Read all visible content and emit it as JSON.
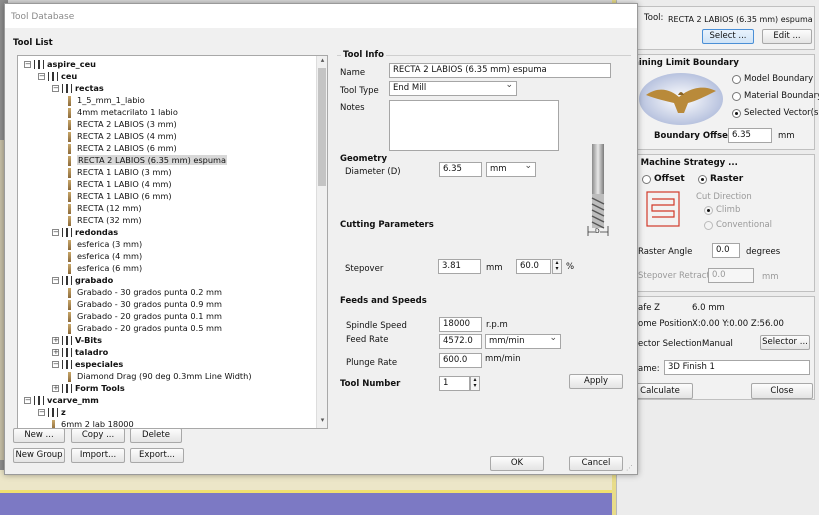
{
  "dialog": {
    "title": "Tool Database",
    "tool_list_label": "Tool List",
    "tree": [
      {
        "label": "aspire_ceu",
        "level": 0,
        "kind": "folder",
        "bold": true
      },
      {
        "label": "ceu",
        "level": 1,
        "kind": "folder",
        "bold": true
      },
      {
        "label": "rectas",
        "level": 2,
        "kind": "folder",
        "bold": true
      },
      {
        "label": "1_5_mm_1_labio",
        "level": 3,
        "kind": "tool"
      },
      {
        "label": "4mm metacrilato 1 labio",
        "level": 3,
        "kind": "tool"
      },
      {
        "label": "RECTA 2 LABIOS (3 mm)",
        "level": 3,
        "kind": "tool"
      },
      {
        "label": "RECTA 2 LABIOS (4 mm)",
        "level": 3,
        "kind": "tool"
      },
      {
        "label": "RECTA 2 LABIOS (6 mm)",
        "level": 3,
        "kind": "tool"
      },
      {
        "label": "RECTA 2 LABIOS (6.35 mm) espuma",
        "level": 3,
        "kind": "tool",
        "selected": true
      },
      {
        "label": "RECTA 1 LABIO (3 mm)",
        "level": 3,
        "kind": "tool"
      },
      {
        "label": "RECTA 1 LABIO (4 mm)",
        "level": 3,
        "kind": "tool"
      },
      {
        "label": "RECTA 1 LABIO (6 mm)",
        "level": 3,
        "kind": "tool"
      },
      {
        "label": "RECTA (12 mm)",
        "level": 3,
        "kind": "tool"
      },
      {
        "label": "RECTA (32 mm)",
        "level": 3,
        "kind": "tool"
      },
      {
        "label": "redondas",
        "level": 2,
        "kind": "folder",
        "bold": true
      },
      {
        "label": "esferica (3 mm)",
        "level": 3,
        "kind": "tool"
      },
      {
        "label": "esferica (4 mm)",
        "level": 3,
        "kind": "tool"
      },
      {
        "label": "esferica (6 mm)",
        "level": 3,
        "kind": "tool"
      },
      {
        "label": "grabado",
        "level": 2,
        "kind": "folder",
        "bold": true
      },
      {
        "label": "Grabado - 30 grados punta 0.2  mm",
        "level": 3,
        "kind": "tool"
      },
      {
        "label": "Grabado - 30 grados punta 0.9  mm",
        "level": 3,
        "kind": "tool"
      },
      {
        "label": "Grabado - 20 grados punta 0.1  mm",
        "level": 3,
        "kind": "tool"
      },
      {
        "label": "Grabado - 20 grados punta 0.5  mm",
        "level": 3,
        "kind": "tool"
      },
      {
        "label": "V-Bits",
        "level": 2,
        "kind": "folder",
        "bold": true,
        "collapsed": true
      },
      {
        "label": "taladro",
        "level": 2,
        "kind": "folder",
        "bold": true,
        "collapsed": true
      },
      {
        "label": "especiales",
        "level": 2,
        "kind": "folder",
        "bold": true
      },
      {
        "label": "Diamond Drag (90 deg 0.3mm Line Width)",
        "level": 3,
        "kind": "tool"
      },
      {
        "label": "Form Tools",
        "level": 2,
        "kind": "folder",
        "bold": true,
        "collapsed": true
      },
      {
        "label": "vcarve_mm",
        "level": 0,
        "kind": "folder",
        "bold": true
      },
      {
        "label": "z",
        "level": 1,
        "kind": "folder",
        "bold": true
      },
      {
        "label": "6mm 2 lab 18000",
        "level": 2,
        "kind": "tool"
      }
    ],
    "buttons": {
      "new": "New ...",
      "copy": "Copy ...",
      "delete": "Delete",
      "new_group": "New Group",
      "import": "Import...",
      "export": "Export...",
      "ok": "OK",
      "cancel": "Cancel",
      "apply": "Apply"
    },
    "tool_info": {
      "heading": "Tool Info",
      "name_label": "Name",
      "name_value": "RECTA 2 LABIOS (6.35 mm) espuma",
      "type_label": "Tool Type",
      "type_value": "End Mill",
      "notes_label": "Notes",
      "notes_value": ""
    },
    "geometry": {
      "heading": "Geometry",
      "diameter_label": "Diameter (D)",
      "diameter_value": "6.35",
      "units_value": "mm",
      "d_symbol": "D"
    },
    "cutting": {
      "heading": "Cutting Parameters",
      "stepover_label": "Stepover",
      "stepover_value": "3.81",
      "stepover_unit": "mm",
      "stepover_pct": "60.0",
      "pct_sign": "%"
    },
    "feeds": {
      "heading": "Feeds and Speeds",
      "spindle_label": "Spindle Speed",
      "spindle_value": "18000",
      "spindle_unit": "r.p.m",
      "feed_label": "Feed Rate",
      "feed_value": "4572.0",
      "feed_unit": "mm/min",
      "plunge_label": "Plunge Rate",
      "plunge_value": "600.0",
      "plunge_unit": "mm/min"
    },
    "tool_number": {
      "label": "Tool Number",
      "value": "1"
    }
  },
  "right_panel": {
    "tool_label": "Tool:",
    "tool_value": "RECTA 2 LABIOS (6.35 mm) espuma",
    "select_btn": "Select ...",
    "edit_btn": "Edit ...",
    "mlb_heading": "achining Limit Boundary",
    "model_boundary": "Model Boundary",
    "material_boundary": "Material Boundary",
    "selected_vectors": "Selected Vector(s)",
    "boundary_offset_label": "Boundary Offset",
    "boundary_offset_value": "6.35",
    "boundary_offset_unit": "mm",
    "strategy_heading": "rea Machine Strategy ...",
    "offset": "Offset",
    "raster": "Raster",
    "cut_direction": "Cut Direction",
    "climb": "Climb",
    "conventional": "Conventional",
    "raster_angle_label": "Raster Angle",
    "raster_angle_value": "0.0",
    "raster_angle_unit": "degrees",
    "stepover_retract_label": "Stepover Retract",
    "stepover_retract_value": "0.0",
    "stepover_retract_unit": "mm",
    "safe_z_label": "afe Z",
    "safe_z_value": "6.0 mm",
    "home_label": "ome Position",
    "home_value": "X:0.00 Y:0.00 Z:56.00",
    "vector_sel_label": "ector Selection:",
    "vector_sel_value": "Manual",
    "selector_btn": "Selector ...",
    "name_label": "ame:",
    "name_value": "3D Finish 1",
    "calculate": "Calculate",
    "close": "Close"
  }
}
